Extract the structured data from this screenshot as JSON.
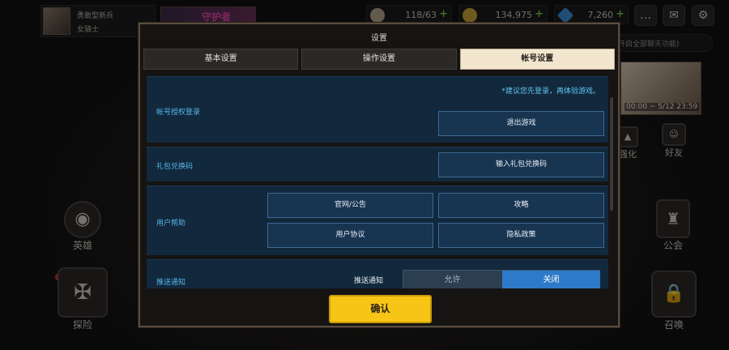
{
  "player": {
    "name": "勇敢型新兵",
    "class": "女骑士"
  },
  "event_banner": {
    "text": "守护者"
  },
  "resources": [
    {
      "icon": "stamina-icon",
      "value": "118/63",
      "color": "#b5a58f"
    },
    {
      "icon": "gold-coin-icon",
      "value": "134,975",
      "color": "#c9a23a"
    },
    {
      "icon": "gem-icon",
      "value": "7,260",
      "color": "#3a8fd9"
    }
  ],
  "top_buttons": [
    {
      "icon": "chat-bubble-icon",
      "glyph": "…"
    },
    {
      "icon": "mail-icon",
      "glyph": "✉"
    },
    {
      "icon": "gear-icon",
      "glyph": "⚙"
    }
  ],
  "chat": {
    "text": "开启全部聊天功能)"
  },
  "event_card": {
    "time": "00:00 ~ 5/12 23:59"
  },
  "side_icons": {
    "enhance": "强化",
    "friend": "好友",
    "hero": "英雄",
    "guild": "公会",
    "explore": "探险",
    "summon": "召唤"
  },
  "modal": {
    "title": "设置",
    "tabs": [
      {
        "label": "基本设置",
        "active": false
      },
      {
        "label": "操作设置",
        "active": false
      },
      {
        "label": "帐号设置",
        "active": true
      }
    ],
    "account": {
      "label": "帐号授权登录",
      "hint": "*建议您先登录，再体验游戏。",
      "logout_button": "退出游戏"
    },
    "gift": {
      "label": "礼包兑换码",
      "button": "输入礼包兑换码"
    },
    "help": {
      "label": "用户帮助",
      "buttons": [
        "官网/公告",
        "攻略",
        "用户协议",
        "隐私政策"
      ]
    },
    "push": {
      "label": "推送通知",
      "sub_label": "推送通知",
      "options": {
        "allow": "允许",
        "off": "关闭"
      },
      "selected": "关闭"
    },
    "confirm_button": "确认"
  }
}
